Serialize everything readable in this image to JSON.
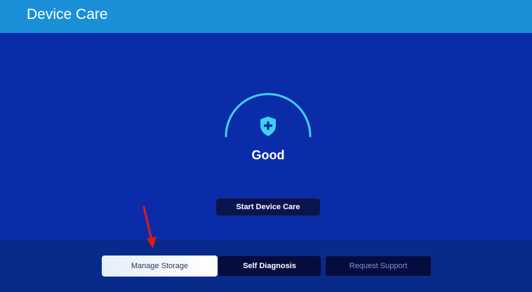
{
  "header": {
    "title": "Device Care"
  },
  "status": {
    "label": "Good",
    "icon": "shield-plus-icon"
  },
  "actions": {
    "start_label": "Start Device Care"
  },
  "bottom_menu": {
    "items": [
      {
        "label": "Manage Storage",
        "state": "focused"
      },
      {
        "label": "Self Diagnosis",
        "state": "normal"
      },
      {
        "label": "Request Support",
        "state": "dimmed"
      }
    ]
  },
  "annotation": {
    "arrow_color": "#e01818"
  },
  "colors": {
    "header_bg": "#1a8fd8",
    "main_bg": "#0b2ca8",
    "bottom_bg": "#082a8a",
    "gauge_accent": "#3fd0f0"
  }
}
